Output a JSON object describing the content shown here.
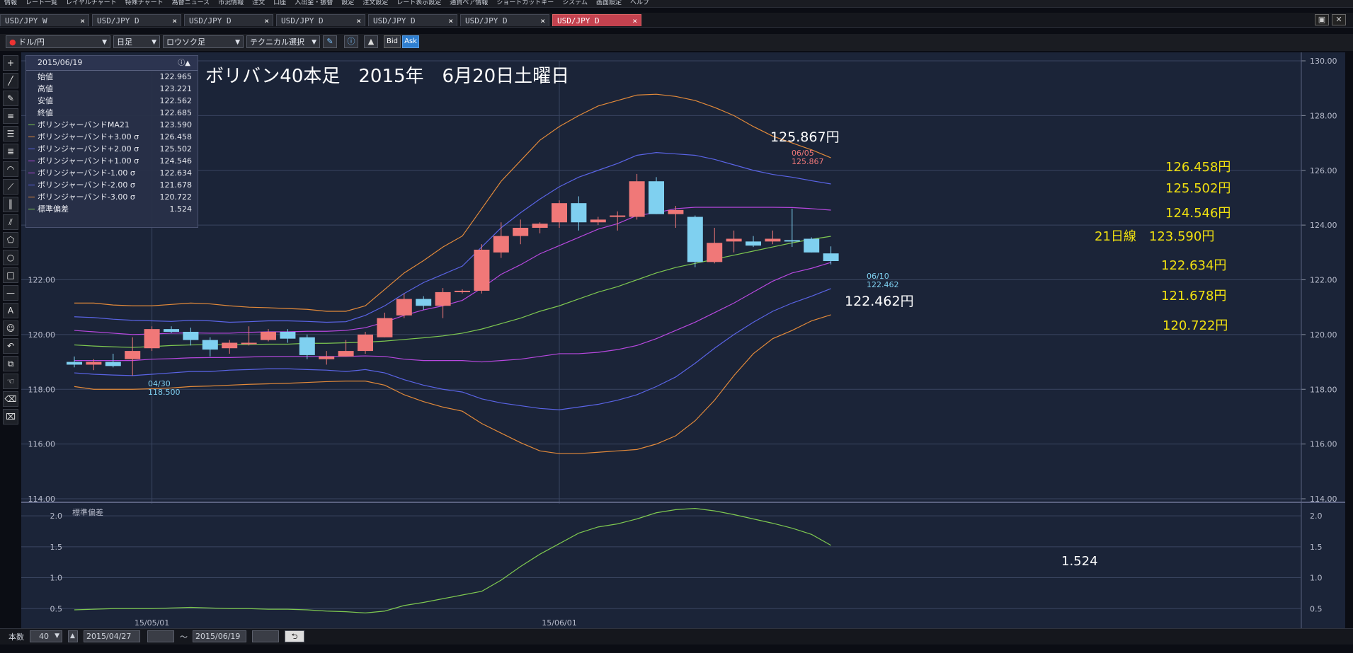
{
  "menubar": {
    "items": [
      "情報",
      "レート一覧",
      "レイヤルチャート",
      "特殊チャート",
      "為替ニュース",
      "市況情報",
      "注文",
      "口座",
      "入出金・振替",
      "設定",
      "注文設定",
      "レート表示設定",
      "通貨ペア情報",
      "ショートカットキー",
      "システム",
      "画面設定",
      "ヘルプ"
    ]
  },
  "tabs": [
    {
      "label": "USD/JPY W"
    },
    {
      "label": "USD/JPY D"
    },
    {
      "label": "USD/JPY D"
    },
    {
      "label": "USD/JPY D"
    },
    {
      "label": "USD/JPY D"
    },
    {
      "label": "USD/JPY D"
    },
    {
      "label": "USD/JPY D",
      "active": true
    }
  ],
  "tab_close": "×",
  "toolbar": {
    "pair": "ドル/円",
    "timeframe": "日足",
    "charttype": "ロウソク足",
    "technical": "テクニカル選択",
    "bid": "Bid",
    "ask": "Ask"
  },
  "infopanel": {
    "date": "2015/06/19",
    "rows": [
      {
        "label": "始値",
        "value": "122.965",
        "color": ""
      },
      {
        "label": "高値",
        "value": "123.221",
        "color": ""
      },
      {
        "label": "安値",
        "value": "122.562",
        "color": ""
      },
      {
        "label": "終値",
        "value": "122.685",
        "color": ""
      },
      {
        "label": "ボリンジャーバンドMA21",
        "value": "123.590",
        "color": "#7ec850"
      },
      {
        "label": "ボリンジャーバンド+3.00 σ",
        "value": "126.458",
        "color": "#e38a3a"
      },
      {
        "label": "ボリンジャーバンド+2.00 σ",
        "value": "125.502",
        "color": "#5a64e6"
      },
      {
        "label": "ボリンジャーバンド+1.00 σ",
        "value": "124.546",
        "color": "#b848e0"
      },
      {
        "label": "ボリンジャーバンド-1.00 σ",
        "value": "122.634",
        "color": "#b848e0"
      },
      {
        "label": "ボリンジャーバンド-2.00 σ",
        "value": "121.678",
        "color": "#5a64e6"
      },
      {
        "label": "ボリンジャーバンド-3.00 σ",
        "value": "120.722",
        "color": "#e38a3a"
      },
      {
        "label": "標準偏差",
        "value": "1.524",
        "color": "#7ec850"
      }
    ]
  },
  "bottombar": {
    "count_label": "本数",
    "count": "40",
    "from": "2015/04/27",
    "tilde": "～",
    "to": "2015/06/19"
  },
  "chart_data": {
    "type": "candlestick",
    "title": "ボリバン40本足　2015年　6月20日土曜日",
    "ylim": [
      114,
      130
    ],
    "yticks": [
      "130.00",
      "128.00",
      "126.00",
      "124.00",
      "122.00",
      "120.00",
      "118.00",
      "116.00",
      "114.00"
    ],
    "xticks": [
      "15/05/01",
      "15/06/01"
    ],
    "candles": [
      [
        119.0,
        119.2,
        118.8,
        118.9
      ],
      [
        118.9,
        119.1,
        118.7,
        119.0
      ],
      [
        119.0,
        119.3,
        118.8,
        118.85
      ],
      [
        119.1,
        119.9,
        118.5,
        119.4
      ],
      [
        119.5,
        120.3,
        119.4,
        120.2
      ],
      [
        120.2,
        120.3,
        120.05,
        120.1
      ],
      [
        120.1,
        120.25,
        119.6,
        119.8
      ],
      [
        119.8,
        119.9,
        119.2,
        119.45
      ],
      [
        119.5,
        119.8,
        119.3,
        119.7
      ],
      [
        119.7,
        120.3,
        119.6,
        119.7
      ],
      [
        119.8,
        120.2,
        119.75,
        120.1
      ],
      [
        120.1,
        120.2,
        119.7,
        119.85
      ],
      [
        119.9,
        120.0,
        119.1,
        119.25
      ],
      [
        119.1,
        119.4,
        118.9,
        119.2
      ],
      [
        119.2,
        119.8,
        119.2,
        119.4
      ],
      [
        119.4,
        120.1,
        119.3,
        120.0
      ],
      [
        119.9,
        120.8,
        119.9,
        120.6
      ],
      [
        120.7,
        121.5,
        120.6,
        121.3
      ],
      [
        121.3,
        121.4,
        120.9,
        121.05
      ],
      [
        121.05,
        121.7,
        120.6,
        121.55
      ],
      [
        121.55,
        121.65,
        121.5,
        121.6
      ],
      [
        121.6,
        123.3,
        121.5,
        123.1
      ],
      [
        123.0,
        124.1,
        122.8,
        123.6
      ],
      [
        123.6,
        124.2,
        123.3,
        123.9
      ],
      [
        123.9,
        124.1,
        123.7,
        124.05
      ],
      [
        124.1,
        124.9,
        123.9,
        124.8
      ],
      [
        124.8,
        125.05,
        123.8,
        124.1
      ],
      [
        124.1,
        124.3,
        124.0,
        124.2
      ],
      [
        124.3,
        124.5,
        123.8,
        124.35
      ],
      [
        124.3,
        125.867,
        124.2,
        125.6
      ],
      [
        125.6,
        125.75,
        124.4,
        124.4
      ],
      [
        124.4,
        124.7,
        123.9,
        124.55
      ],
      [
        124.3,
        124.35,
        122.462,
        122.65
      ],
      [
        122.65,
        123.9,
        122.6,
        123.35
      ],
      [
        123.4,
        123.8,
        123.0,
        123.5
      ],
      [
        123.4,
        123.6,
        123.2,
        123.25
      ],
      [
        123.4,
        123.8,
        123.3,
        123.5
      ],
      [
        123.45,
        124.6,
        123.2,
        123.4
      ],
      [
        123.5,
        123.55,
        123.0,
        123.0
      ],
      [
        122.965,
        123.221,
        122.562,
        122.685
      ]
    ],
    "bands": {
      "ma21": [
        119.62,
        119.58,
        119.55,
        119.53,
        119.56,
        119.6,
        119.62,
        119.63,
        119.63,
        119.64,
        119.65,
        119.65,
        119.68,
        119.68,
        119.7,
        119.72,
        119.76,
        119.82,
        119.88,
        119.95,
        120.05,
        120.2,
        120.4,
        120.6,
        120.85,
        121.05,
        121.3,
        121.55,
        121.75,
        122.0,
        122.25,
        122.45,
        122.6,
        122.75,
        122.9,
        123.05,
        123.2,
        123.35,
        123.48,
        123.59
      ],
      "p1": [
        120.15,
        120.1,
        120.05,
        120.0,
        120.02,
        120.05,
        120.06,
        120.05,
        120.05,
        120.08,
        120.1,
        120.1,
        120.12,
        120.12,
        120.15,
        120.25,
        120.45,
        120.7,
        120.9,
        121.05,
        121.25,
        121.7,
        122.2,
        122.55,
        122.95,
        123.25,
        123.55,
        123.85,
        124.05,
        124.35,
        124.45,
        124.6,
        124.65,
        124.65,
        124.65,
        124.65,
        124.65,
        124.64,
        124.6,
        124.546
      ],
      "p2": [
        120.65,
        120.62,
        120.56,
        120.52,
        120.5,
        120.48,
        120.52,
        120.5,
        120.45,
        120.47,
        120.5,
        120.5,
        120.48,
        120.45,
        120.47,
        120.7,
        121.05,
        121.5,
        121.9,
        122.2,
        122.5,
        123.2,
        123.9,
        124.45,
        124.95,
        125.4,
        125.75,
        126.0,
        126.25,
        126.55,
        126.65,
        126.6,
        126.55,
        126.4,
        126.2,
        126.0,
        125.85,
        125.75,
        125.62,
        125.502
      ],
      "p3": [
        121.15,
        121.15,
        121.08,
        121.05,
        121.05,
        121.1,
        121.15,
        121.12,
        121.05,
        121.0,
        120.98,
        120.95,
        120.92,
        120.85,
        120.85,
        121.05,
        121.65,
        122.25,
        122.7,
        123.2,
        123.6,
        124.6,
        125.6,
        126.35,
        127.1,
        127.6,
        128.0,
        128.35,
        128.55,
        128.75,
        128.78,
        128.7,
        128.55,
        128.3,
        128.0,
        127.6,
        127.25,
        127.0,
        126.75,
        126.458
      ],
      "m1": [
        119.05,
        119.05,
        119.05,
        119.05,
        119.1,
        119.12,
        119.15,
        119.16,
        119.16,
        119.18,
        119.2,
        119.2,
        119.2,
        119.2,
        119.2,
        119.22,
        119.2,
        119.1,
        119.05,
        119.05,
        119.05,
        119.0,
        119.05,
        119.1,
        119.2,
        119.3,
        119.3,
        119.35,
        119.45,
        119.6,
        119.85,
        120.15,
        120.45,
        120.8,
        121.15,
        121.55,
        121.95,
        122.25,
        122.42,
        122.634
      ],
      "m2": [
        118.6,
        118.55,
        118.52,
        118.5,
        118.55,
        118.6,
        118.65,
        118.65,
        118.7,
        118.72,
        118.75,
        118.75,
        118.72,
        118.7,
        118.65,
        118.72,
        118.6,
        118.35,
        118.15,
        118.0,
        117.9,
        117.65,
        117.5,
        117.4,
        117.3,
        117.25,
        117.35,
        117.45,
        117.6,
        117.8,
        118.1,
        118.45,
        118.95,
        119.5,
        120.0,
        120.45,
        120.85,
        121.15,
        121.4,
        121.678
      ],
      "m3": [
        118.1,
        118.0,
        118.0,
        118.0,
        118.02,
        118.05,
        118.1,
        118.12,
        118.15,
        118.18,
        118.2,
        118.22,
        118.25,
        118.28,
        118.3,
        118.3,
        118.15,
        117.8,
        117.55,
        117.35,
        117.2,
        116.75,
        116.4,
        116.05,
        115.75,
        115.65,
        115.65,
        115.7,
        115.75,
        115.8,
        116.0,
        116.3,
        116.85,
        117.6,
        118.5,
        119.3,
        119.85,
        120.15,
        120.5,
        120.722
      ]
    },
    "stddev": {
      "ylim": [
        0.4,
        2.15
      ],
      "yticks": [
        "2.0",
        "1.5",
        "1.0",
        "0.5"
      ],
      "label": "標準偏差",
      "values": [
        0.48,
        0.49,
        0.5,
        0.5,
        0.5,
        0.51,
        0.52,
        0.51,
        0.5,
        0.5,
        0.49,
        0.49,
        0.48,
        0.46,
        0.45,
        0.43,
        0.46,
        0.55,
        0.6,
        0.66,
        0.72,
        0.78,
        0.96,
        1.18,
        1.38,
        1.55,
        1.72,
        1.82,
        1.87,
        1.95,
        2.05,
        2.1,
        2.12,
        2.08,
        2.02,
        1.95,
        1.88,
        1.8,
        1.7,
        1.524
      ]
    },
    "annotations": {
      "high_label": "125.867円",
      "high_date": "06/05",
      "high_value": "125.867",
      "low_label": "122.462円",
      "low_date": "06/10",
      "low_value": "122.462",
      "left_low_date": "04/30",
      "left_low_value": "118.500",
      "right_p3": "126.458円",
      "right_p2": "125.502円",
      "right_p1": "124.546円",
      "right_ma": "21日線　123.590円",
      "right_m1": "122.634円",
      "right_m2": "121.678円",
      "right_m3": "120.722円",
      "std_value": "1.524"
    },
    "colors": {
      "up": "#f07878",
      "down": "#7fd0f0",
      "ma21": "#7ec850",
      "sigma1": "#b848e0",
      "sigma2": "#5a64e6",
      "sigma3": "#e38a3a",
      "right_labels": "#f0e010"
    }
  }
}
